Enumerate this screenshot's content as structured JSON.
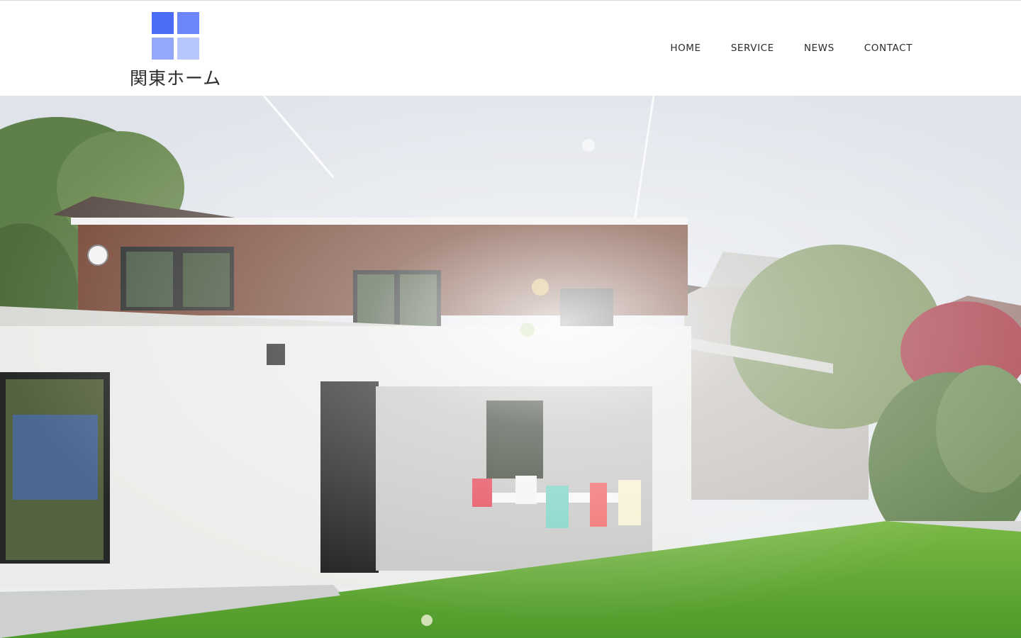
{
  "brand": {
    "name": "関東ホーム",
    "mark_colors": [
      "#4a6cf7",
      "#6a86f8",
      "#93a8fa",
      "#b7c6fc"
    ]
  },
  "nav": {
    "items": [
      {
        "label": "HOME"
      },
      {
        "label": "SERVICE"
      },
      {
        "label": "NEWS"
      },
      {
        "label": "CONTACT"
      }
    ]
  },
  "hero": {
    "image": "house-exterior-with-garden-photo"
  }
}
